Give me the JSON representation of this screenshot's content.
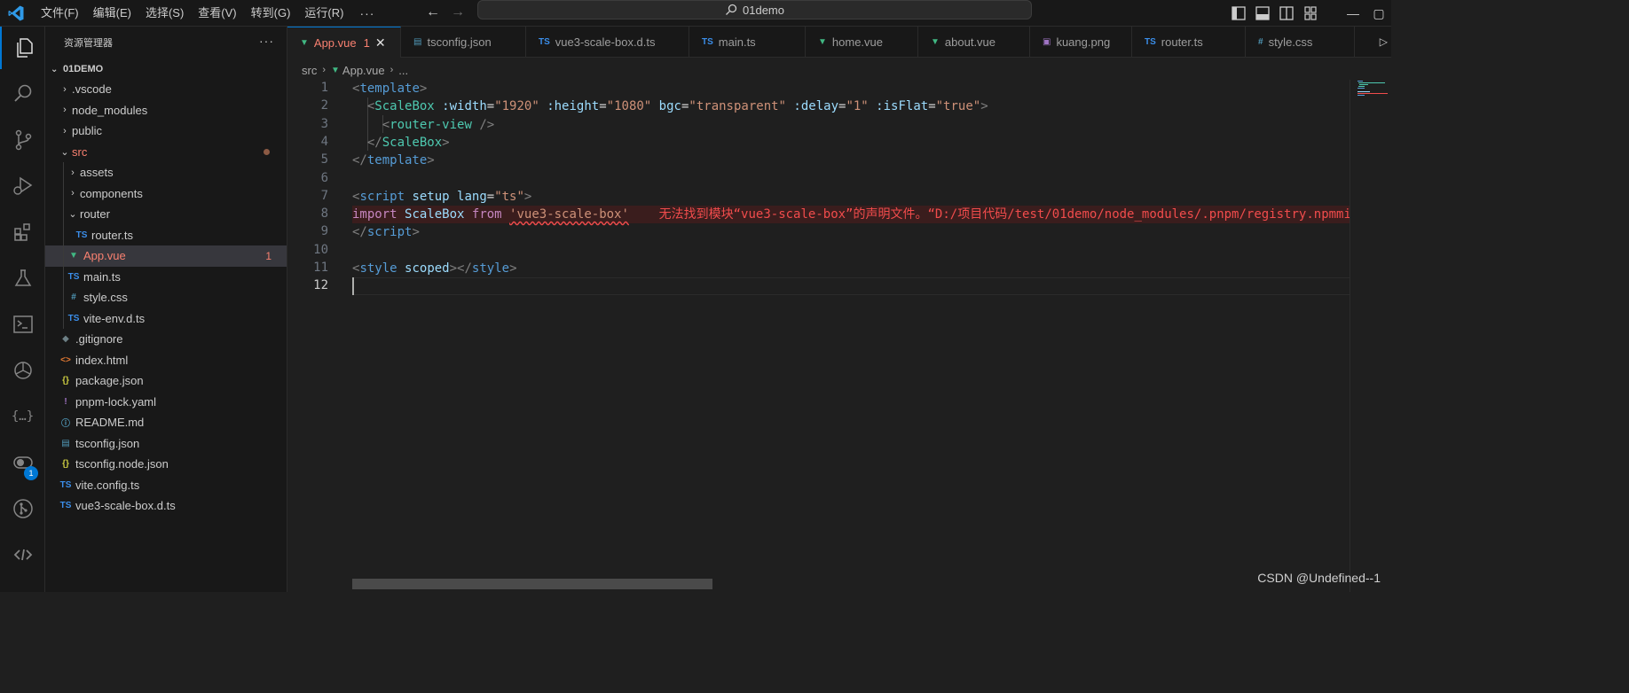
{
  "titlebar": {
    "menu": [
      "文件(F)",
      "编辑(E)",
      "选择(S)",
      "查看(V)",
      "转到(G)",
      "运行(R)"
    ],
    "more": "···",
    "search_text": "01demo"
  },
  "sidebar": {
    "title": "资源管理器",
    "more": "···",
    "root": "01DEMO",
    "items": [
      {
        "label": ".vscode",
        "icon": "",
        "icon_color": "#cccccc"
      },
      {
        "label": "node_modules",
        "icon": "",
        "icon_color": "#cccccc"
      },
      {
        "label": "public",
        "icon": "",
        "icon_color": "#cccccc"
      },
      {
        "label": "src",
        "icon": "",
        "icon_color": "#cccccc"
      },
      {
        "label": "assets",
        "icon": "",
        "icon_color": "#cccccc"
      },
      {
        "label": "components",
        "icon": "",
        "icon_color": "#cccccc"
      },
      {
        "label": "router",
        "icon": "",
        "icon_color": "#cccccc"
      },
      {
        "label": "router.ts",
        "icon": "TS",
        "icon_color": "#3b8eea"
      },
      {
        "label": "App.vue",
        "icon": "▼",
        "icon_color": "#41b883",
        "count": "1"
      },
      {
        "label": "main.ts",
        "icon": "TS",
        "icon_color": "#3b8eea"
      },
      {
        "label": "style.css",
        "icon": "#",
        "icon_color": "#519aba"
      },
      {
        "label": "vite-env.d.ts",
        "icon": "TS",
        "icon_color": "#3b8eea"
      },
      {
        "label": ".gitignore",
        "icon": "◆",
        "icon_color": "#6d8086"
      },
      {
        "label": "index.html",
        "icon": "<>",
        "icon_color": "#e37933"
      },
      {
        "label": "package.json",
        "icon": "{}",
        "icon_color": "#cbcb41"
      },
      {
        "label": "pnpm-lock.yaml",
        "icon": "!",
        "icon_color": "#a074c4"
      },
      {
        "label": "README.md",
        "icon": "ⓘ",
        "icon_color": "#519aba"
      },
      {
        "label": "tsconfig.json",
        "icon": "▤",
        "icon_color": "#519aba"
      },
      {
        "label": "tsconfig.node.json",
        "icon": "{}",
        "icon_color": "#cbcb41"
      },
      {
        "label": "vite.config.ts",
        "icon": "TS",
        "icon_color": "#3b8eea"
      },
      {
        "label": "vue3-scale-box.d.ts",
        "icon": "TS",
        "icon_color": "#3b8eea"
      }
    ]
  },
  "tabs": [
    {
      "label": "App.vue",
      "icon": "▼",
      "icon_color": "#41b883",
      "count": "1",
      "close": "✕"
    },
    {
      "label": "tsconfig.json",
      "icon": "▤",
      "icon_color": "#519aba"
    },
    {
      "label": "vue3-scale-box.d.ts",
      "icon": "TS",
      "icon_color": "#3b8eea"
    },
    {
      "label": "main.ts",
      "icon": "TS",
      "icon_color": "#3b8eea"
    },
    {
      "label": "home.vue",
      "icon": "▼",
      "icon_color": "#41b883"
    },
    {
      "label": "about.vue",
      "icon": "▼",
      "icon_color": "#41b883"
    },
    {
      "label": "kuang.png",
      "icon": "▣",
      "icon_color": "#a074c4"
    },
    {
      "label": "router.ts",
      "icon": "TS",
      "icon_color": "#3b8eea"
    },
    {
      "label": "style.css",
      "icon": "#",
      "icon_color": "#519aba"
    }
  ],
  "breadcrumb": {
    "folder": "src",
    "file": "App.vue",
    "tail": "..."
  },
  "editor": {
    "line_numbers": [
      "1",
      "2",
      "3",
      "4",
      "5",
      "6",
      "7",
      "8",
      "9",
      "10",
      "11",
      "12"
    ],
    "lines": [
      [
        [
          "t-tag",
          "<"
        ],
        [
          "t-name",
          "template"
        ],
        [
          "t-tag",
          ">"
        ]
      ],
      [
        [
          "t-plain",
          "  "
        ],
        [
          "t-tag",
          "<"
        ],
        [
          "t-comp",
          "ScaleBox"
        ],
        [
          "t-plain",
          " "
        ],
        [
          "t-attr",
          ":width"
        ],
        [
          "t-plain",
          "="
        ],
        [
          "t-str",
          "\"1920\""
        ],
        [
          "t-plain",
          " "
        ],
        [
          "t-attr",
          ":height"
        ],
        [
          "t-plain",
          "="
        ],
        [
          "t-str",
          "\"1080\""
        ],
        [
          "t-plain",
          " "
        ],
        [
          "t-attr",
          "bgc"
        ],
        [
          "t-plain",
          "="
        ],
        [
          "t-str",
          "\"transparent\""
        ],
        [
          "t-plain",
          " "
        ],
        [
          "t-attr",
          ":delay"
        ],
        [
          "t-plain",
          "="
        ],
        [
          "t-str",
          "\"1\""
        ],
        [
          "t-plain",
          " "
        ],
        [
          "t-attr",
          ":isFlat"
        ],
        [
          "t-plain",
          "="
        ],
        [
          "t-str",
          "\"true\""
        ],
        [
          "t-tag",
          ">"
        ]
      ],
      [
        [
          "t-plain",
          "    "
        ],
        [
          "t-tag",
          "<"
        ],
        [
          "t-comp",
          "router-view"
        ],
        [
          "t-plain",
          " "
        ],
        [
          "t-tag",
          "/>"
        ]
      ],
      [
        [
          "t-plain",
          "  "
        ],
        [
          "t-tag",
          "</"
        ],
        [
          "t-comp",
          "ScaleBox"
        ],
        [
          "t-tag",
          ">"
        ]
      ],
      [
        [
          "t-tag",
          "</"
        ],
        [
          "t-name",
          "template"
        ],
        [
          "t-tag",
          ">"
        ]
      ],
      [],
      [
        [
          "t-tag",
          "<"
        ],
        [
          "t-name",
          "script"
        ],
        [
          "t-plain",
          " "
        ],
        [
          "t-attr",
          "setup"
        ],
        [
          "t-plain",
          " "
        ],
        [
          "t-attr",
          "lang"
        ],
        [
          "t-plain",
          "="
        ],
        [
          "t-str",
          "\"ts\""
        ],
        [
          "t-tag",
          ">"
        ]
      ],
      [
        [
          "t-kw",
          "import"
        ],
        [
          "t-plain",
          " "
        ],
        [
          "t-id",
          "ScaleBox"
        ],
        [
          "t-plain",
          " "
        ],
        [
          "t-kw",
          "from"
        ],
        [
          "t-plain",
          " "
        ],
        [
          "t-str squiggle",
          "'vue3-scale-box'"
        ],
        [
          "t-plain",
          "    "
        ],
        [
          "t-err",
          "无法找到模块“vue3-scale-box”的声明文件。“D:/项目代码/test/01demo/node_modules/.pnpm/registry.npmmi"
        ]
      ],
      [
        [
          "t-tag",
          "</"
        ],
        [
          "t-name",
          "script"
        ],
        [
          "t-tag",
          ">"
        ]
      ],
      [],
      [
        [
          "t-tag",
          "<"
        ],
        [
          "t-name",
          "style"
        ],
        [
          "t-plain",
          " "
        ],
        [
          "t-attr",
          "scoped"
        ],
        [
          "t-tag",
          "></"
        ],
        [
          "t-name",
          "style"
        ],
        [
          "t-tag",
          ">"
        ]
      ],
      []
    ]
  },
  "watermark": "CSDN @Undefined--1"
}
